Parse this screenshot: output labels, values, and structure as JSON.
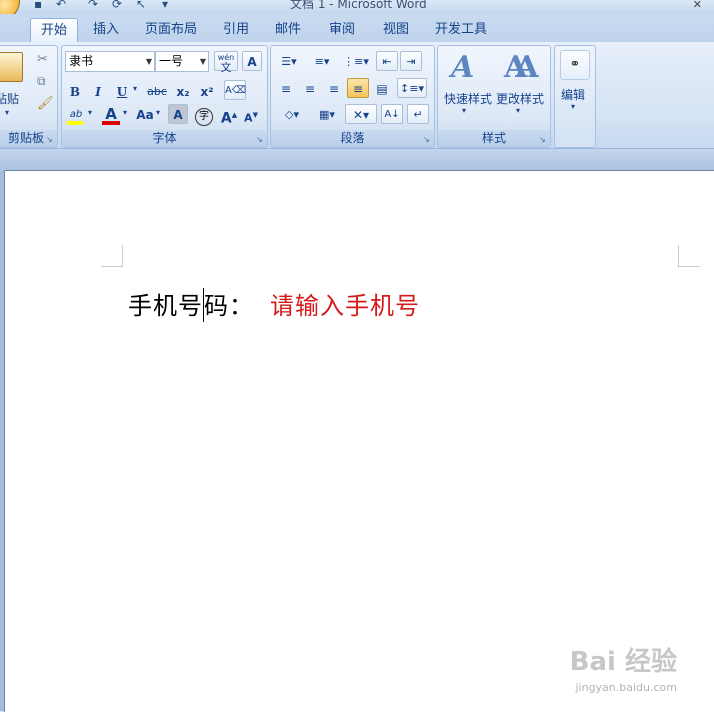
{
  "window": {
    "title": "文档 1 - Microsoft Word"
  },
  "tabs": [
    "开始",
    "插入",
    "页面布局",
    "引用",
    "邮件",
    "审阅",
    "视图",
    "开发工具"
  ],
  "clipboard": {
    "paste_label": "粘贴",
    "group_label": "剪贴板"
  },
  "font": {
    "name": "隶书",
    "size": "一号",
    "group_label": "字体",
    "bold": "B",
    "italic": "I",
    "underline": "U",
    "strike": "abc",
    "subscript": "x₂",
    "superscript": "x²",
    "grow": "A",
    "shrink": "A",
    "change_case": "Aa",
    "char_shading": "A",
    "enclose": "字",
    "phonetic": "wén",
    "phonetic_char": "文",
    "highlight": "ab",
    "font_color_letter": "A",
    "font_color": "#e00000",
    "highlight_color": "#ffff00"
  },
  "paragraph": {
    "group_label": "段落"
  },
  "styles": {
    "quick_styles_label": "快速样式",
    "change_styles_label": "更改样式",
    "group_label": "样式"
  },
  "editing": {
    "label": "编辑"
  },
  "document": {
    "label_text": "手机号码：",
    "label_before_caret": "手机号",
    "label_after_caret": "码：",
    "placeholder_text": "请输入手机号",
    "placeholder_color": "#d61a1a"
  },
  "watermark": {
    "brand": "Bai 经验",
    "url": "jingyan.baidu.com"
  }
}
